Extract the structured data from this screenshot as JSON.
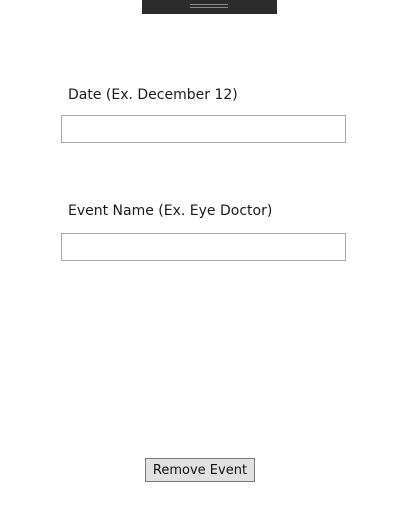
{
  "form": {
    "date": {
      "label": "Date (Ex. December 12)",
      "value": "",
      "placeholder": ""
    },
    "event_name": {
      "label": "Event Name (Ex. Eye Doctor)",
      "value": "",
      "placeholder": ""
    },
    "remove_button_label": "Remove Event"
  },
  "colors": {
    "background": "#ffffff",
    "handle": "#2b2b2b",
    "input_border": "#a9a9a9",
    "button_face": "#e1e1e1",
    "button_border": "#7a7a7a"
  }
}
